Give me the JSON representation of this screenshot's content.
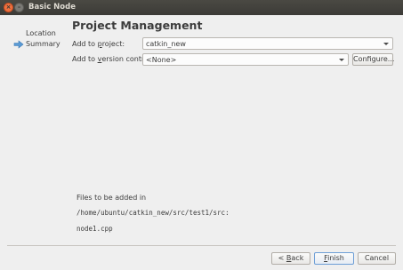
{
  "window": {
    "title": "Basic Node",
    "close_glyph": "×",
    "min_glyph": "–"
  },
  "sidebar": {
    "items": [
      {
        "label": "Location"
      },
      {
        "label": "Summary",
        "icon": "arrow-right-icon"
      }
    ]
  },
  "page": {
    "title": "Project Management"
  },
  "form": {
    "project": {
      "label_pre": "Add to ",
      "label_u": "p",
      "label_post": "roject:",
      "value": "catkin_new"
    },
    "vcs": {
      "label_pre": "Add to ",
      "label_u": "v",
      "label_post": "ersion control:",
      "value": "<None>",
      "configure_label": "Configure..."
    }
  },
  "files": {
    "heading": "Files to be added in",
    "path": "/home/ubuntu/catkin_new/src/test1/src:",
    "file": "node1.cpp"
  },
  "footer": {
    "back_pre": "< ",
    "back_u": "B",
    "back_post": "ack",
    "finish_u": "F",
    "finish_post": "inish",
    "cancel_label": "Cancel"
  },
  "colors": {
    "accent": "#5b9bd5",
    "titlebar": "#3c3b37",
    "close": "#f0713f"
  }
}
